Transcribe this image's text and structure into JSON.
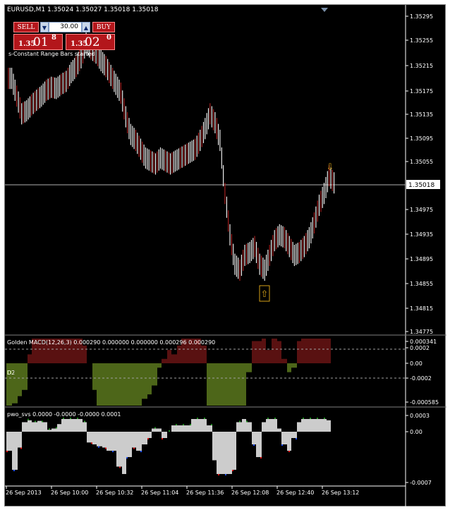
{
  "chart_header": {
    "symbol_tf": "EURUSD,M1",
    "ohlc": "1.35024 1.35027 1.35018 1.35018"
  },
  "trade_panel": {
    "sell_label": "SELL",
    "buy_label": "BUY",
    "lots_value": "30.00",
    "down_glyph": "▼",
    "up_glyph": "▲",
    "sell_price": {
      "small": "1.35",
      "big": "01",
      "sup": "8"
    },
    "buy_price": {
      "small": "1.35",
      "big": "02",
      "sup": "0"
    }
  },
  "status_text": "s-Constant Range Bars started",
  "main_axis": {
    "ticks": [
      "1.35295",
      "1.35255",
      "1.35215",
      "1.35175",
      "1.35135",
      "1.35095",
      "1.35055",
      "1.34975",
      "1.34935",
      "1.34895",
      "1.34855",
      "1.34815",
      "1.34775"
    ],
    "current_price": "1.35018"
  },
  "macd": {
    "label": "Golden MACD(12,26,3) 0.000290 0.000000 0.000000 0.000296 0.000290",
    "left_markers": [
      "D1",
      "D2"
    ],
    "ticks": [
      "0.000341",
      "0.0002",
      "0.00",
      "-0.0002",
      "-0.000585"
    ]
  },
  "pwo": {
    "label": "pwo_svs 0.0000 -0.0000 -0.0000 0.0001",
    "ticks": [
      "0.0003",
      "0.00",
      "-0.0007"
    ]
  },
  "time_axis": [
    "26 Sep 2013",
    "26 Sep 10:00",
    "26 Sep 10:32",
    "26 Sep 11:04",
    "26 Sep 11:36",
    "26 Sep 12:08",
    "26 Sep 12:40",
    "26 Sep 13:12"
  ],
  "signals": {
    "up_arrow": "⇧",
    "down_arrow": "⇩"
  },
  "colors": {
    "background": "#000000",
    "bar_up": "#ffffff",
    "bar_down": "#b22222",
    "macd_hist_pos": "#b22222",
    "macd_hist_neg": "#9acd32",
    "signal_box": "#d4a017",
    "pwo_blue": "#1e50ff",
    "pwo_green": "#1e8c1e",
    "pwo_red": "#e01010"
  },
  "chart_data": {
    "type": "bar",
    "title": "EURUSD,M1",
    "series": [
      {
        "name": "EURUSD",
        "values": [
          1.35195,
          1.35165,
          1.35135,
          1.3514,
          1.3515,
          1.35158,
          1.35165,
          1.35175,
          1.3518,
          1.35178,
          1.35185,
          1.3519,
          1.35205,
          1.35215,
          1.3523,
          1.35255,
          1.35245,
          1.35238,
          1.35225,
          1.35215,
          1.352,
          1.35185,
          1.3517,
          1.3513,
          1.351,
          1.3509,
          1.35075,
          1.3506,
          1.35055,
          1.3505,
          1.3506,
          1.35055,
          1.3505,
          1.35055,
          1.3506,
          1.35065,
          1.3507,
          1.35075,
          1.3509,
          1.3511,
          1.35135,
          1.3512,
          1.3509,
          1.35,
          1.3493,
          1.3488,
          1.3487,
          1.34895,
          1.349,
          1.3491,
          1.3488,
          1.3487,
          1.34895,
          1.3492,
          1.3493,
          1.34925,
          1.3491,
          1.34895,
          1.349,
          1.3491,
          1.34925,
          1.3495,
          1.3498,
          1.35,
          1.3503,
          1.35018
        ]
      }
    ],
    "ylim": [
      1.3476,
      1.3531
    ],
    "grid": false
  }
}
